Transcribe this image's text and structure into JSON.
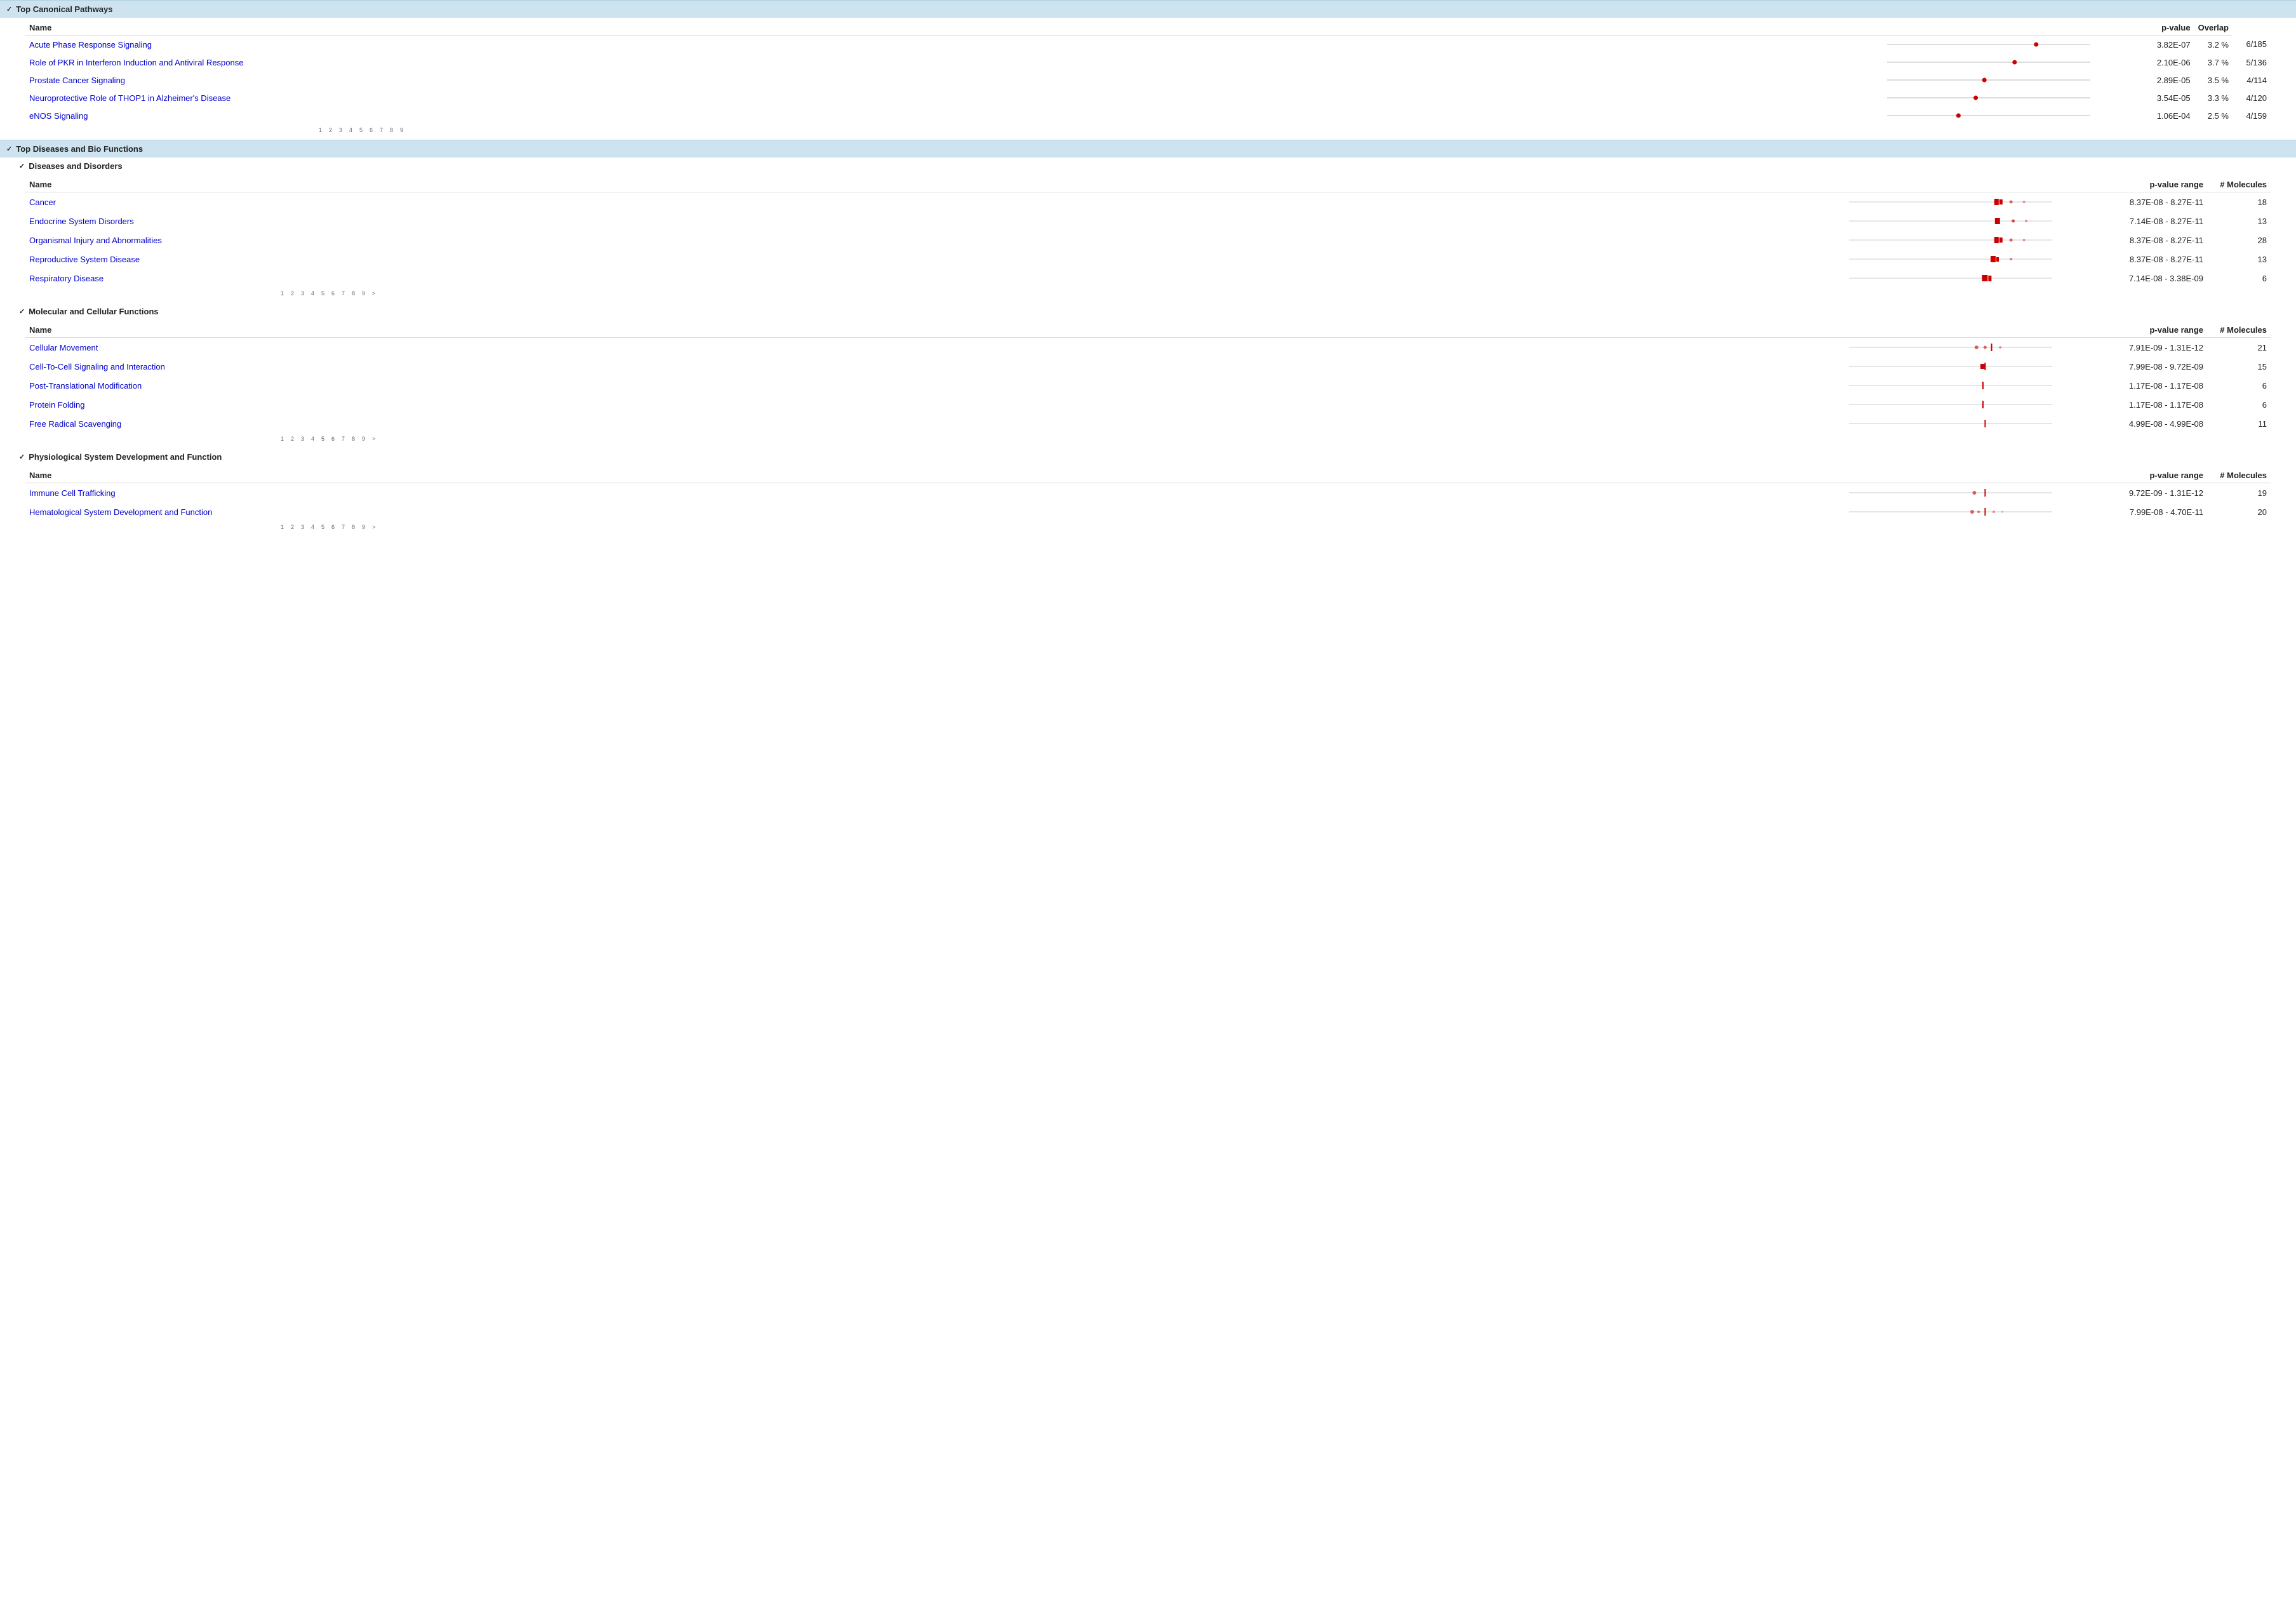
{
  "sections": {
    "top_canonical_pathways": {
      "title": "Top Canonical Pathways",
      "columns": [
        "Name",
        "p-value",
        "Overlap"
      ],
      "rows": [
        {
          "name": "Acute Phase Response Signaling",
          "pvalue": "3.82E-07",
          "overlap_pct": "3.2 %",
          "overlap_frac": "6/185"
        },
        {
          "name": "Role of PKR in Interferon Induction and Antiviral Response",
          "pvalue": "2.10E-06",
          "overlap_pct": "3.7 %",
          "overlap_frac": "5/136"
        },
        {
          "name": "Prostate Cancer Signaling",
          "pvalue": "2.89E-05",
          "overlap_pct": "3.5 %",
          "overlap_frac": "4/114"
        },
        {
          "name": "Neuroprotective Role of THOP1 in Alzheimer's Disease",
          "pvalue": "3.54E-05",
          "overlap_pct": "3.3 %",
          "overlap_frac": "4/120"
        },
        {
          "name": "eNOS Signaling",
          "pvalue": "1.06E-04",
          "overlap_pct": "2.5 %",
          "overlap_frac": "4/159"
        }
      ],
      "axis_ticks": [
        "1",
        "2",
        "3",
        "4",
        "5",
        "6",
        "7",
        "8",
        "9"
      ]
    },
    "top_diseases": {
      "title": "Top Diseases and Bio Functions",
      "subsections": [
        {
          "title": "Diseases and Disorders",
          "columns": [
            "Name",
            "p-value range",
            "# Molecules"
          ],
          "rows": [
            {
              "name": "Cancer",
              "pvalue_range": "8.37E-08 - 8.27E-11",
              "nmol": "18",
              "chart_type": "double_sq"
            },
            {
              "name": "Endocrine System Disorders",
              "pvalue_range": "7.14E-08 - 8.27E-11",
              "nmol": "13",
              "chart_type": "single_sq"
            },
            {
              "name": "Organismal Injury and Abnormalities",
              "pvalue_range": "8.37E-08 - 8.27E-11",
              "nmol": "28",
              "chart_type": "double_sq"
            },
            {
              "name": "Reproductive System Disease",
              "pvalue_range": "8.37E-08 - 8.27E-11",
              "nmol": "13",
              "chart_type": "single_sq2"
            },
            {
              "name": "Respiratory Disease",
              "pvalue_range": "7.14E-08 - 3.38E-09",
              "nmol": "6",
              "chart_type": "double_sq3"
            }
          ],
          "axis_ticks": [
            "1",
            "2",
            "3",
            "4",
            "5",
            "6",
            "7",
            "8",
            "9",
            ">"
          ]
        },
        {
          "title": "Molecular and Cellular Functions",
          "columns": [
            "Name",
            "p-value range",
            "# Molecules"
          ],
          "rows": [
            {
              "name": "Cellular Movement",
              "pvalue_range": "7.91E-09 - 1.31E-12",
              "nmol": "21",
              "chart_type": "mv1"
            },
            {
              "name": "Cell-To-Cell Signaling and Interaction",
              "pvalue_range": "7.99E-08 - 9.72E-09",
              "nmol": "15",
              "chart_type": "mv2"
            },
            {
              "name": "Post-Translational Modification",
              "pvalue_range": "1.17E-08 - 1.17E-08",
              "nmol": "6",
              "chart_type": "mv3"
            },
            {
              "name": "Protein Folding",
              "pvalue_range": "1.17E-08 - 1.17E-08",
              "nmol": "6",
              "chart_type": "mv3"
            },
            {
              "name": "Free Radical Scavenging",
              "pvalue_range": "4.99E-08 - 4.99E-08",
              "nmol": "11",
              "chart_type": "mv4"
            }
          ],
          "axis_ticks": [
            "1",
            "2",
            "3",
            "4",
            "5",
            "6",
            "7",
            "8",
            "9",
            ">"
          ]
        }
      ]
    },
    "physiological": {
      "title": "Physiological System Development and Function",
      "columns": [
        "Name",
        "p-value range",
        "# Molecules"
      ],
      "rows": [
        {
          "name": "Immune Cell Trafficking",
          "pvalue_range": "9.72E-09 - 1.31E-12",
          "nmol": "19",
          "chart_type": "phy1"
        },
        {
          "name": "Hematological System Development and Function",
          "pvalue_range": "7.99E-08 - 4.70E-11",
          "nmol": "20",
          "chart_type": "phy2"
        }
      ],
      "axis_ticks": [
        "1",
        "2",
        "3",
        "4",
        "5",
        "6",
        "7",
        "8",
        "9",
        ">"
      ]
    }
  },
  "colors": {
    "link": "#0000cc",
    "red": "#cc0000",
    "header_bg": "#cde4f0",
    "axis": "#999999"
  }
}
